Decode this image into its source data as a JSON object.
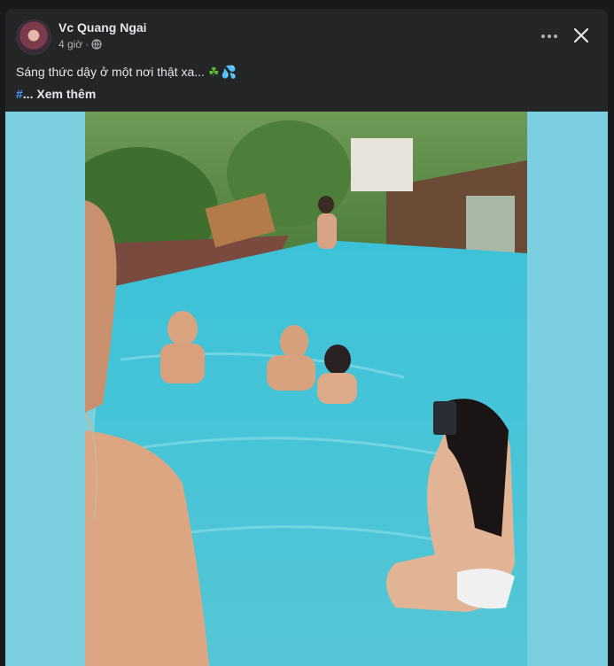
{
  "post": {
    "author": "Vc Quang Ngai",
    "time": "4 giờ",
    "separator": "·",
    "caption": "Sáng thức dậy ở một nơi thật xa...",
    "hashtag": "#",
    "see_more": "... Xem thêm"
  },
  "colors": {
    "background": "#18191a",
    "card": "#242526",
    "media_backdrop": "#7ccfe0",
    "link": "#4599ff"
  },
  "icons": {
    "privacy": "globe-icon",
    "menu": "more-horizontal-icon",
    "close": "close-icon",
    "emoji_1": "herb-emoji",
    "emoji_2": "sweat-droplets-emoji"
  }
}
